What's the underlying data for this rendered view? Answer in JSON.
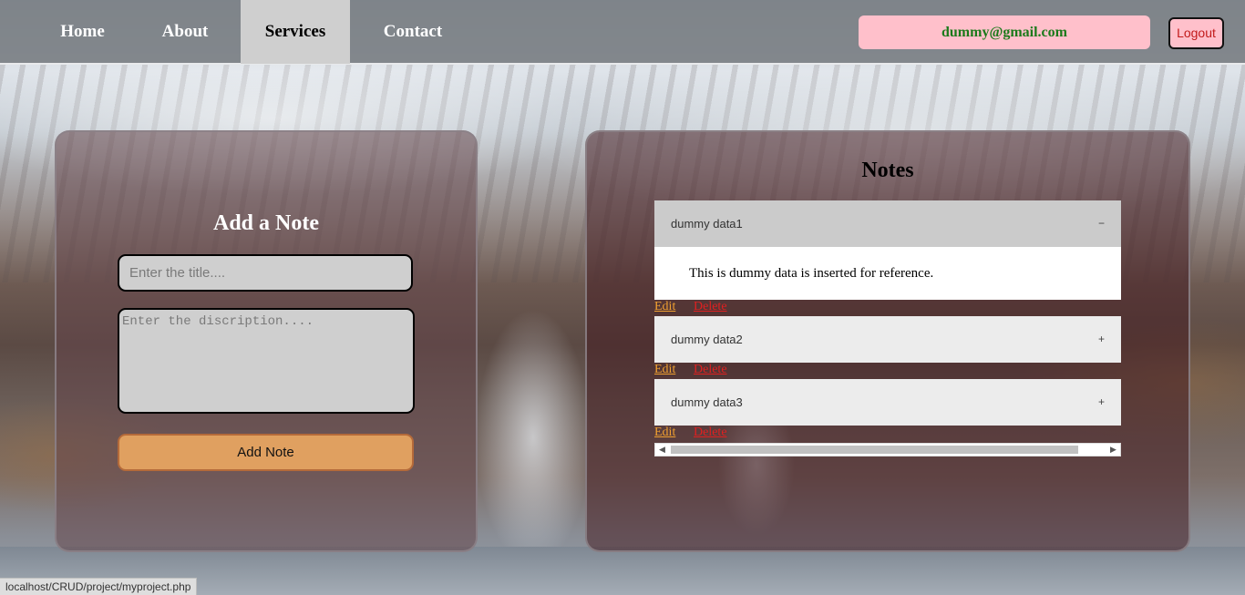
{
  "nav": {
    "links": [
      {
        "label": "Home",
        "active": false
      },
      {
        "label": "About",
        "active": false
      },
      {
        "label": "Services",
        "active": true
      },
      {
        "label": "Contact",
        "active": false
      }
    ],
    "user_email": "dummy@gmail.com",
    "logout_label": "Logout"
  },
  "add_note": {
    "heading": "Add a Note",
    "title_placeholder": "Enter the title....",
    "description_placeholder": "Enter the discription....",
    "button_label": "Add Note"
  },
  "notes": {
    "heading": "Notes",
    "items": [
      {
        "title": "dummy data1",
        "sign": "−",
        "expanded": true,
        "body": "This is dummy data is inserted for reference.",
        "edit_label": "Edit",
        "delete_label": "Delete"
      },
      {
        "title": "dummy data2",
        "sign": "+",
        "expanded": false,
        "edit_label": "Edit",
        "delete_label": "Delete"
      },
      {
        "title": "dummy data3",
        "sign": "+",
        "expanded": false,
        "edit_label": "Edit",
        "delete_label": "Delete"
      }
    ]
  },
  "status_bar": {
    "url": "localhost/CRUD/project/myproject.php"
  },
  "colors": {
    "email_bg": "#ffc0cb",
    "email_text": "#1b7a1b",
    "logout_text": "#c21a1a",
    "add_button": "#e0a060",
    "edit_link": "#f0a030",
    "delete_link": "#e02020"
  }
}
